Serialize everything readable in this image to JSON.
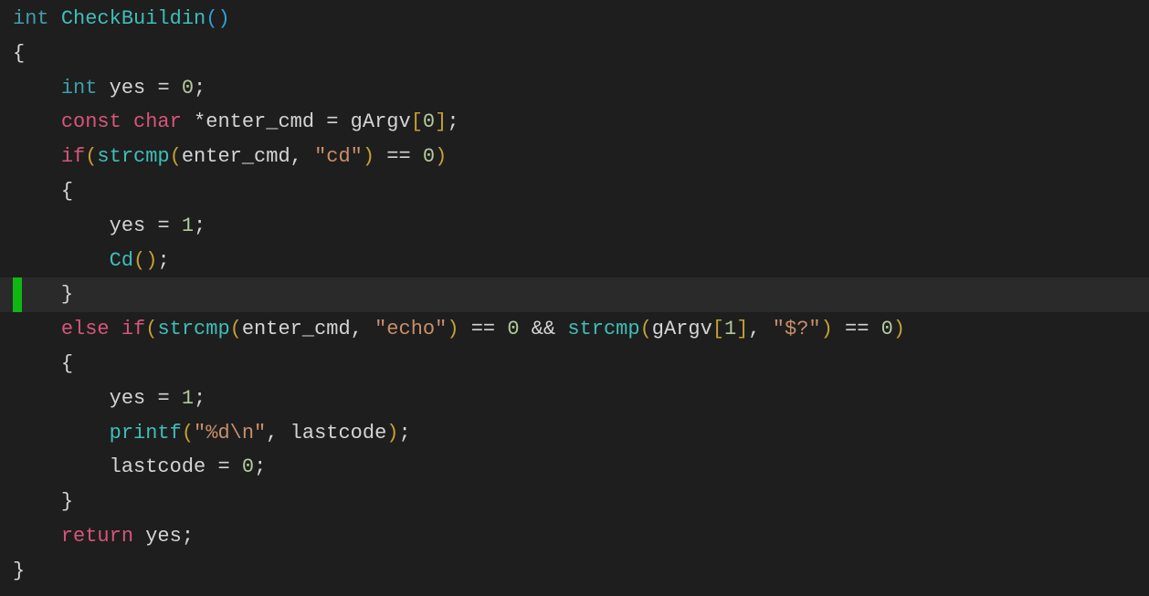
{
  "code": {
    "lines": [
      {
        "indent": 0,
        "highlight": false,
        "cursor": false,
        "tokens": [
          {
            "cls": "tk-type",
            "t": "int"
          },
          {
            "cls": "tk-ident",
            "t": " "
          },
          {
            "cls": "tk-func",
            "t": "CheckBuildin"
          },
          {
            "cls": "tk-hlparen",
            "t": "("
          },
          {
            "cls": "tk-hlparen",
            "t": ")"
          }
        ]
      },
      {
        "indent": 0,
        "highlight": false,
        "cursor": false,
        "tokens": [
          {
            "cls": "tk-punct",
            "t": "{"
          }
        ]
      },
      {
        "indent": 1,
        "highlight": false,
        "cursor": false,
        "tokens": [
          {
            "cls": "tk-type",
            "t": "int"
          },
          {
            "cls": "tk-ident",
            "t": " yes "
          },
          {
            "cls": "tk-punct",
            "t": "="
          },
          {
            "cls": "tk-ident",
            "t": " "
          },
          {
            "cls": "tk-num",
            "t": "0"
          },
          {
            "cls": "tk-punct",
            "t": ";"
          }
        ]
      },
      {
        "indent": 1,
        "highlight": false,
        "cursor": false,
        "tokens": [
          {
            "cls": "tk-kw",
            "t": "const"
          },
          {
            "cls": "tk-ident",
            "t": " "
          },
          {
            "cls": "tk-kw",
            "t": "char"
          },
          {
            "cls": "tk-ident",
            "t": " "
          },
          {
            "cls": "tk-punct",
            "t": "*"
          },
          {
            "cls": "tk-ident",
            "t": "enter_cmd "
          },
          {
            "cls": "tk-punct",
            "t": "="
          },
          {
            "cls": "tk-ident",
            "t": " gArgv"
          },
          {
            "cls": "tk-bracket",
            "t": "["
          },
          {
            "cls": "tk-num",
            "t": "0"
          },
          {
            "cls": "tk-bracket",
            "t": "]"
          },
          {
            "cls": "tk-punct",
            "t": ";"
          }
        ]
      },
      {
        "indent": 1,
        "highlight": false,
        "cursor": false,
        "tokens": [
          {
            "cls": "tk-kw",
            "t": "if"
          },
          {
            "cls": "tk-paren",
            "t": "("
          },
          {
            "cls": "tk-func",
            "t": "strcmp"
          },
          {
            "cls": "tk-paren",
            "t": "("
          },
          {
            "cls": "tk-ident",
            "t": "enter_cmd"
          },
          {
            "cls": "tk-punct",
            "t": ","
          },
          {
            "cls": "tk-ident",
            "t": " "
          },
          {
            "cls": "tk-str",
            "t": "\"cd\""
          },
          {
            "cls": "tk-paren",
            "t": ")"
          },
          {
            "cls": "tk-ident",
            "t": " "
          },
          {
            "cls": "tk-punct",
            "t": "=="
          },
          {
            "cls": "tk-ident",
            "t": " "
          },
          {
            "cls": "tk-num",
            "t": "0"
          },
          {
            "cls": "tk-paren",
            "t": ")"
          }
        ]
      },
      {
        "indent": 1,
        "highlight": false,
        "cursor": false,
        "tokens": [
          {
            "cls": "tk-punct",
            "t": "{"
          }
        ]
      },
      {
        "indent": 2,
        "highlight": false,
        "cursor": false,
        "tokens": [
          {
            "cls": "tk-ident",
            "t": "yes "
          },
          {
            "cls": "tk-punct",
            "t": "="
          },
          {
            "cls": "tk-ident",
            "t": " "
          },
          {
            "cls": "tk-num",
            "t": "1"
          },
          {
            "cls": "tk-punct",
            "t": ";"
          }
        ]
      },
      {
        "indent": 2,
        "highlight": false,
        "cursor": false,
        "tokens": [
          {
            "cls": "tk-func",
            "t": "Cd"
          },
          {
            "cls": "tk-paren",
            "t": "("
          },
          {
            "cls": "tk-paren",
            "t": ")"
          },
          {
            "cls": "tk-punct",
            "t": ";"
          }
        ]
      },
      {
        "indent": 1,
        "highlight": true,
        "cursor": true,
        "tokens": [
          {
            "cls": "tk-punct",
            "t": "}"
          }
        ]
      },
      {
        "indent": 1,
        "highlight": false,
        "cursor": false,
        "tokens": [
          {
            "cls": "tk-kw",
            "t": "else"
          },
          {
            "cls": "tk-ident",
            "t": " "
          },
          {
            "cls": "tk-kw",
            "t": "if"
          },
          {
            "cls": "tk-paren",
            "t": "("
          },
          {
            "cls": "tk-func",
            "t": "strcmp"
          },
          {
            "cls": "tk-paren",
            "t": "("
          },
          {
            "cls": "tk-ident",
            "t": "enter_cmd"
          },
          {
            "cls": "tk-punct",
            "t": ","
          },
          {
            "cls": "tk-ident",
            "t": " "
          },
          {
            "cls": "tk-str",
            "t": "\"echo\""
          },
          {
            "cls": "tk-paren",
            "t": ")"
          },
          {
            "cls": "tk-ident",
            "t": " "
          },
          {
            "cls": "tk-punct",
            "t": "=="
          },
          {
            "cls": "tk-ident",
            "t": " "
          },
          {
            "cls": "tk-num",
            "t": "0"
          },
          {
            "cls": "tk-ident",
            "t": " "
          },
          {
            "cls": "tk-punct",
            "t": "&&"
          },
          {
            "cls": "tk-ident",
            "t": " "
          },
          {
            "cls": "tk-func",
            "t": "strcmp"
          },
          {
            "cls": "tk-paren",
            "t": "("
          },
          {
            "cls": "tk-ident",
            "t": "gArgv"
          },
          {
            "cls": "tk-bracket",
            "t": "["
          },
          {
            "cls": "tk-num",
            "t": "1"
          },
          {
            "cls": "tk-bracket",
            "t": "]"
          },
          {
            "cls": "tk-punct",
            "t": ","
          },
          {
            "cls": "tk-ident",
            "t": " "
          },
          {
            "cls": "tk-str",
            "t": "\"$?\""
          },
          {
            "cls": "tk-paren",
            "t": ")"
          },
          {
            "cls": "tk-ident",
            "t": " "
          },
          {
            "cls": "tk-punct",
            "t": "=="
          },
          {
            "cls": "tk-ident",
            "t": " "
          },
          {
            "cls": "tk-num",
            "t": "0"
          },
          {
            "cls": "tk-paren",
            "t": ")"
          }
        ]
      },
      {
        "indent": 1,
        "highlight": false,
        "cursor": false,
        "tokens": [
          {
            "cls": "tk-punct",
            "t": "{"
          }
        ]
      },
      {
        "indent": 2,
        "highlight": false,
        "cursor": false,
        "tokens": [
          {
            "cls": "tk-ident",
            "t": "yes "
          },
          {
            "cls": "tk-punct",
            "t": "="
          },
          {
            "cls": "tk-ident",
            "t": " "
          },
          {
            "cls": "tk-num",
            "t": "1"
          },
          {
            "cls": "tk-punct",
            "t": ";"
          }
        ]
      },
      {
        "indent": 2,
        "highlight": false,
        "cursor": false,
        "tokens": [
          {
            "cls": "tk-func",
            "t": "printf"
          },
          {
            "cls": "tk-paren",
            "t": "("
          },
          {
            "cls": "tk-str",
            "t": "\"%d\\n\""
          },
          {
            "cls": "tk-punct",
            "t": ","
          },
          {
            "cls": "tk-ident",
            "t": " lastcode"
          },
          {
            "cls": "tk-paren",
            "t": ")"
          },
          {
            "cls": "tk-punct",
            "t": ";"
          }
        ]
      },
      {
        "indent": 2,
        "highlight": false,
        "cursor": false,
        "tokens": [
          {
            "cls": "tk-ident",
            "t": "lastcode "
          },
          {
            "cls": "tk-punct",
            "t": "="
          },
          {
            "cls": "tk-ident",
            "t": " "
          },
          {
            "cls": "tk-num",
            "t": "0"
          },
          {
            "cls": "tk-punct",
            "t": ";"
          }
        ]
      },
      {
        "indent": 1,
        "highlight": false,
        "cursor": false,
        "tokens": [
          {
            "cls": "tk-punct",
            "t": "}"
          }
        ]
      },
      {
        "indent": 1,
        "highlight": false,
        "cursor": false,
        "tokens": [
          {
            "cls": "tk-kw",
            "t": "return"
          },
          {
            "cls": "tk-ident",
            "t": " yes"
          },
          {
            "cls": "tk-punct",
            "t": ";"
          }
        ]
      },
      {
        "indent": 0,
        "highlight": false,
        "cursor": false,
        "tokens": [
          {
            "cls": "tk-punct",
            "t": "}"
          }
        ]
      }
    ],
    "indent_unit": "    "
  }
}
